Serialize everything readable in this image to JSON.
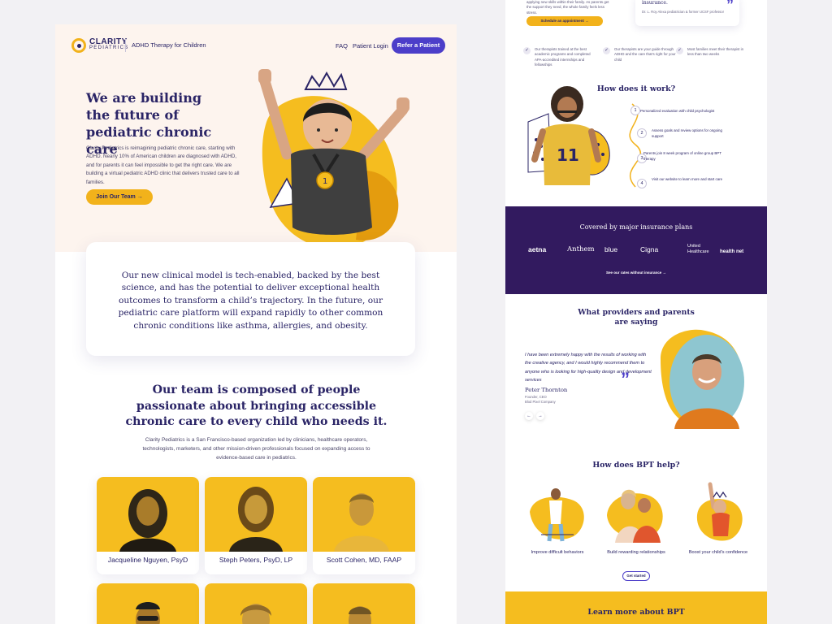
{
  "brand": {
    "logo_name": "CLARITY",
    "logo_sub": "PEDIATRICS",
    "tagline": "ADHD Therapy for Children",
    "colors": {
      "navy": "#2a2466",
      "yellow": "#f2b21b",
      "purple": "#4c3ec9",
      "deep_purple": "#321a5f",
      "cream": "#fdf4ee"
    }
  },
  "nav": {
    "faq": "FAQ",
    "login": "Patient Login",
    "refer": "Refer a Patient"
  },
  "hero": {
    "title": "We are building the future of pediatric chronic care",
    "body": "Clarity Pediatrics is reimagining pediatric chronic care, starting with ADHD. Nearly 10% of American children are diagnosed with ADHD, and for parents it can feel impossible to get the right care. We are building a virtual pediatric ADHD clinic that delivers trusted care to all families.",
    "cta": "Join Our Team  →"
  },
  "mission": {
    "text": "Our new clinical model is tech-enabled, backed by the best science, and has the potential to deliver exceptional health outcomes to transform a child’s trajectory. In the future, our pediatric care platform will expand rapidly to other common chronic conditions like asthma, allergies, and obesity."
  },
  "team": {
    "title": "Our team is composed of people passionate about bringing accessible chronic care to every child who needs it.",
    "body": "Clarity Pediatrics is a San Francisco-based organization led by clinicians, healthcare operators, technologists, marketers, and other mission-driven professionals focused on expanding access to evidence-based care in pediatrics.",
    "members": [
      {
        "name": "Jacqueline Nguyen, PsyD"
      },
      {
        "name": "Steph Peters, PsyD, LP"
      },
      {
        "name": "Scott Cohen, MD, FAAP"
      }
    ]
  },
  "right": {
    "intro": "applying new skills within their family. As parents get the support they need, the whole family feels less stress.",
    "schedule": "Schedule an appointment  →",
    "quote": {
      "text": "insurance.",
      "author": "Dr. L. Roy Alexa pediatrician & former UCSF professor"
    },
    "features": [
      {
        "text": "Our therapists trained at the best academic programs and completed APA-accredited internships and fellowships"
      },
      {
        "text": "Our therapists are your guide through ADHD and the care that’s right for your child"
      },
      {
        "text": "Most families meet their therapist in less than two weeks"
      }
    ],
    "how_it_works": {
      "title": "How does it work?",
      "steps": [
        {
          "num": "1",
          "text": "Personalized evaluation with child psychologist"
        },
        {
          "num": "2",
          "text": "Assess goals and review options for ongoing support"
        },
        {
          "num": "3",
          "text": "Parents join 8 week program of online group BPT therapy"
        },
        {
          "num": "4",
          "text": "Visit our website to learn more and start care"
        }
      ]
    },
    "insurance": {
      "title": "Covered by major insurance plans",
      "logos": [
        "aetna",
        "Anthem",
        "blue",
        "Cigna",
        "United Healthcare",
        "health net"
      ],
      "link": "See our rates without insurance  →"
    },
    "providers": {
      "title": "What providers and parents are saying",
      "quote": "I have been extremely happy with the results of working with the creative agency, and I would highly recommend them to anyone who is looking for high-quality design and development services",
      "name": "Peter Thornton",
      "role1": "Founder, CEO",
      "role2": "Blod Pixel Company",
      "prev": "←",
      "next": "→"
    },
    "bpt": {
      "title": "How does BPT help?",
      "items": [
        {
          "label": "Improve difficult behaviors"
        },
        {
          "label": "Build rewarding relationships"
        },
        {
          "label": "Boost your child’s confidence"
        }
      ],
      "cta": "Get started"
    },
    "learn": {
      "title": "Learn more about BPT"
    }
  }
}
